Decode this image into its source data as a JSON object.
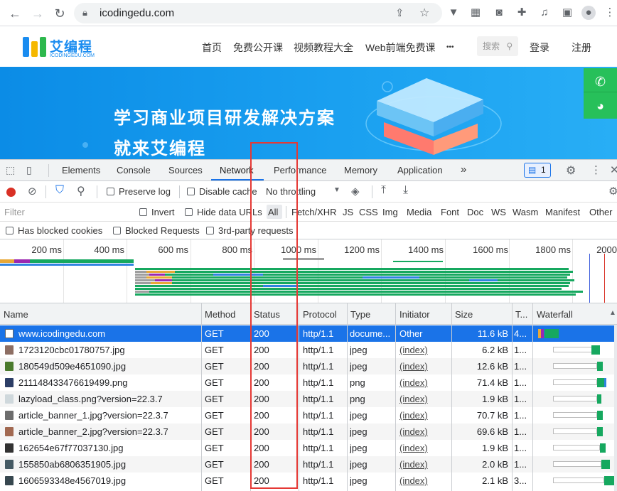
{
  "browser": {
    "url": "icodingedu.com",
    "icons": [
      "back-icon",
      "forward-icon",
      "reload-icon",
      "lock-icon",
      "share-icon",
      "star-icon",
      "extension-icons",
      "profile-icon"
    ]
  },
  "site": {
    "logo_text": "艾编程",
    "logo_sub": "ICODINGEDU.COM",
    "nav": [
      "首页",
      "免费公开课",
      "视频教程大全",
      "Web前端免费课",
      "•••"
    ],
    "search_placeholder": "搜索",
    "login": "登录",
    "register": "注册",
    "banner_line1": "学习商业项目研发解决方案",
    "banner_line2": "就来艾编程",
    "colors": {
      "brand": "#1a8cf0",
      "banner": "#1aa0f0",
      "float": "#27c05a"
    }
  },
  "devtools": {
    "tabs": [
      "Elements",
      "Console",
      "Sources",
      "Network",
      "Performance",
      "Memory",
      "Application"
    ],
    "active_tab": "Network",
    "more_tabs": "»",
    "issues_count": "1",
    "toolbar": {
      "preserve_log": "Preserve log",
      "disable_cache": "Disable cache",
      "throttling": "No throttling"
    },
    "filter": {
      "placeholder": "Filter",
      "invert": "Invert",
      "hide_data_urls": "Hide data URLs",
      "types": [
        "All",
        "Fetch/XHR",
        "JS",
        "CSS",
        "Img",
        "Media",
        "Font",
        "Doc",
        "WS",
        "Wasm",
        "Manifest",
        "Other"
      ]
    },
    "blocked": {
      "has_blocked_cookies": "Has blocked cookies",
      "blocked_requests": "Blocked Requests",
      "third_party": "3rd-party requests"
    },
    "overview_ticks": [
      "200 ms",
      "400 ms",
      "600 ms",
      "800 ms",
      "1000 ms",
      "1200 ms",
      "1400 ms",
      "1600 ms",
      "1800 ms",
      "2000"
    ],
    "columns": [
      "Name",
      "Method",
      "Status",
      "Protocol",
      "Type",
      "Initiator",
      "Size",
      "T...",
      "Waterfall"
    ],
    "rows": [
      {
        "name": "www.icodingedu.com",
        "method": "GET",
        "status": "200",
        "protocol": "http/1.1",
        "type": "docume...",
        "initiator": "Other",
        "size": "11.6 kB",
        "time": "4...",
        "icon": "document-icon"
      },
      {
        "name": "1723120cbc01780757.jpg",
        "method": "GET",
        "status": "200",
        "protocol": "http/1.1",
        "type": "jpeg",
        "initiator": "(index)",
        "size": "6.2 kB",
        "time": "1...",
        "icon": "image-icon"
      },
      {
        "name": "180549d509e4651090.jpg",
        "method": "GET",
        "status": "200",
        "protocol": "http/1.1",
        "type": "jpeg",
        "initiator": "(index)",
        "size": "12.6 kB",
        "time": "1...",
        "icon": "image-icon"
      },
      {
        "name": "211148433476619499.png",
        "method": "GET",
        "status": "200",
        "protocol": "http/1.1",
        "type": "png",
        "initiator": "(index)",
        "size": "71.4 kB",
        "time": "1...",
        "icon": "image-icon"
      },
      {
        "name": "lazyload_class.png?version=22.3.7",
        "method": "GET",
        "status": "200",
        "protocol": "http/1.1",
        "type": "png",
        "initiator": "(index)",
        "size": "1.9 kB",
        "time": "1...",
        "icon": "image-icon"
      },
      {
        "name": "article_banner_1.jpg?version=22.3.7",
        "method": "GET",
        "status": "200",
        "protocol": "http/1.1",
        "type": "jpeg",
        "initiator": "(index)",
        "size": "70.7 kB",
        "time": "1...",
        "icon": "image-icon"
      },
      {
        "name": "article_banner_2.jpg?version=22.3.7",
        "method": "GET",
        "status": "200",
        "protocol": "http/1.1",
        "type": "jpeg",
        "initiator": "(index)",
        "size": "69.6 kB",
        "time": "1...",
        "icon": "image-icon"
      },
      {
        "name": "162654e67f77037130.jpg",
        "method": "GET",
        "status": "200",
        "protocol": "http/1.1",
        "type": "jpeg",
        "initiator": "(index)",
        "size": "1.9 kB",
        "time": "1...",
        "icon": "image-icon"
      },
      {
        "name": "155850ab6806351905.jpg",
        "method": "GET",
        "status": "200",
        "protocol": "http/1.1",
        "type": "jpeg",
        "initiator": "(index)",
        "size": "2.0 kB",
        "time": "1...",
        "icon": "image-icon"
      },
      {
        "name": "1606593348e4567019.jpg",
        "method": "GET",
        "status": "200",
        "protocol": "http/1.1",
        "type": "jpeg",
        "initiator": "(index)",
        "size": "2.1 kB",
        "time": "3...",
        "icon": "image-icon"
      }
    ],
    "colors": {
      "selected_row": "#1a73e8",
      "waterfall_green": "#16a85f",
      "highlight_box": "#e53935"
    }
  }
}
